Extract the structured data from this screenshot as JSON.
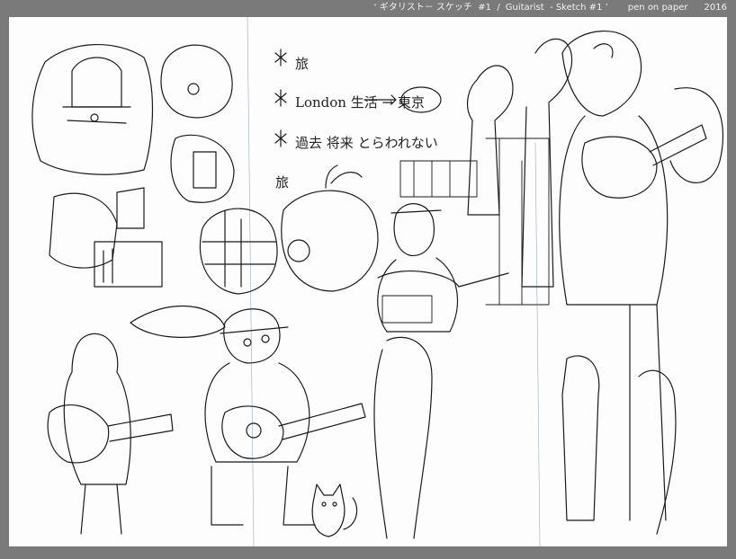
{
  "caption": {
    "title_ja": "‘ ギタリスト－ スケッチ  #1  /",
    "title_en": "Guitarist  - Sketch #1 ’",
    "medium": "pen on paper",
    "year": "2016"
  },
  "colors": {
    "frame": "#7a7a7a",
    "paper": "#fdfdfd",
    "ink": "#1a1a1a",
    "caption": "#f2f2f2"
  },
  "sketch": {
    "notes": [
      "旅",
      "London 生活 → 東京",
      "過去 将来 とらわれない",
      "旅"
    ]
  }
}
